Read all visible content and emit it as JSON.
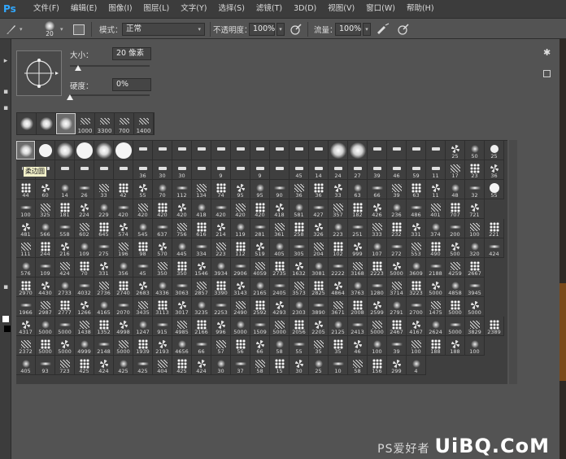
{
  "app": {
    "logo": "Ps"
  },
  "menus": [
    "文件(F)",
    "编辑(E)",
    "图像(I)",
    "图层(L)",
    "文字(Y)",
    "选择(S)",
    "滤镜(T)",
    "3D(D)",
    "视图(V)",
    "窗口(W)",
    "帮助(H)"
  ],
  "options": {
    "brush_size": "20",
    "mode_label": "模式：",
    "mode_value": "正常",
    "opacity_label": "不透明度：",
    "opacity_value": "100%",
    "flow_label": "流量：",
    "flow_value": "100%"
  },
  "brush_panel": {
    "size_label": "大小：",
    "size_value": "20 像素",
    "hardness_label": "硬度：",
    "hardness_value": "0%",
    "size_level": 0.1,
    "hardness_level": 0.0,
    "tooltip": "柔边圆",
    "recent": [
      {
        "num": ""
      },
      {
        "num": ""
      },
      {
        "num": "",
        "selected": true
      },
      {
        "num": "1000"
      },
      {
        "num": "3300"
      },
      {
        "num": "700"
      },
      {
        "num": "1400"
      }
    ],
    "rows": [
      [
        "",
        "",
        "",
        "",
        "",
        "",
        "",
        "",
        "",
        "",
        "",
        "",
        "",
        "",
        "",
        "",
        "",
        "",
        "",
        "",
        "",
        "",
        "25",
        "50",
        "25"
      ],
      [
        "",
        "",
        "",
        "",
        "",
        "",
        "36",
        "30",
        "30",
        "",
        "9",
        "",
        "9",
        "",
        "45",
        "14",
        "24",
        "27",
        "39",
        "46",
        "59",
        "11",
        "17",
        "23",
        "36"
      ],
      [
        "44",
        "60",
        "14",
        "26",
        "33",
        "42",
        "55",
        "70",
        "112",
        "134",
        "74",
        "95",
        "95",
        "90",
        "36",
        "36",
        "33",
        "63",
        "66",
        "39",
        "63",
        "11",
        "48",
        "32",
        "55"
      ],
      [
        "100",
        "325",
        "181",
        "224",
        "229",
        "420",
        "420",
        "420",
        "420",
        "418",
        "420",
        "420",
        "420",
        "418",
        "581",
        "427",
        "357",
        "182",
        "426",
        "236",
        "486",
        "401",
        "707",
        "721"
      ],
      [
        "481",
        "566",
        "558",
        "602",
        "645",
        "574",
        "545",
        "637",
        "756",
        "616",
        "214",
        "119",
        "281",
        "361",
        "258",
        "326",
        "223",
        "251",
        "333",
        "232",
        "331",
        "374",
        "200",
        "100",
        "221"
      ],
      [
        "111",
        "244",
        "216",
        "109",
        "275",
        "196",
        "98",
        "570",
        "445",
        "334",
        "223",
        "112",
        "519",
        "405",
        "305",
        "204",
        "102",
        "999",
        "107",
        "272",
        "553",
        "490",
        "500",
        "320",
        "424"
      ],
      [
        "576",
        "109",
        "424",
        "70",
        "331",
        "356",
        "45",
        "350",
        "350",
        "1546",
        "3934",
        "2906",
        "4059",
        "2735",
        "1632",
        "3081",
        "2222",
        "3168",
        "2223",
        "5000",
        "3609",
        "2188",
        "4259",
        "2667"
      ],
      [
        "2970",
        "4430",
        "2733",
        "4032",
        "2736",
        "2740",
        "2683",
        "4336",
        "3063",
        "2857",
        "3390",
        "3143",
        "2165",
        "2405",
        "3573",
        "2825",
        "4864",
        "3763",
        "1280",
        "3714",
        "3223",
        "5000",
        "4858",
        "3945"
      ],
      [
        "1966",
        "2987",
        "2777",
        "1266",
        "4165",
        "2070",
        "3435",
        "3113",
        "3017",
        "3235",
        "2253",
        "2490",
        "2592",
        "4293",
        "2303",
        "3890",
        "3671",
        "2008",
        "2599",
        "2791",
        "2700",
        "1475",
        "5000",
        "5000"
      ],
      [
        "4317",
        "5000",
        "5000",
        "1438",
        "1352",
        "4998",
        "1247",
        "915",
        "4985",
        "2166",
        "996",
        "5000",
        "1509",
        "5000",
        "2056",
        "2205",
        "2125",
        "2413",
        "5000",
        "2467",
        "4167",
        "2624",
        "5000",
        "3829",
        "2389"
      ],
      [
        "2372",
        "5000",
        "5000",
        "4999",
        "2148",
        "5000",
        "1939",
        "2193",
        "4656",
        "66",
        "57",
        "56",
        "66",
        "58",
        "55",
        "35",
        "35",
        "46",
        "100",
        "39",
        "100",
        "188",
        "188",
        "100"
      ],
      [
        "405",
        "93",
        "723",
        "425",
        "424",
        "425",
        "425",
        "404",
        "425",
        "424",
        "30",
        "37",
        "58",
        "15",
        "30",
        "25",
        "10",
        "58",
        "156",
        "299",
        "4"
      ]
    ]
  },
  "watermark": {
    "prefix": "PS爱好者",
    "text": "UiBQ.CoM"
  }
}
